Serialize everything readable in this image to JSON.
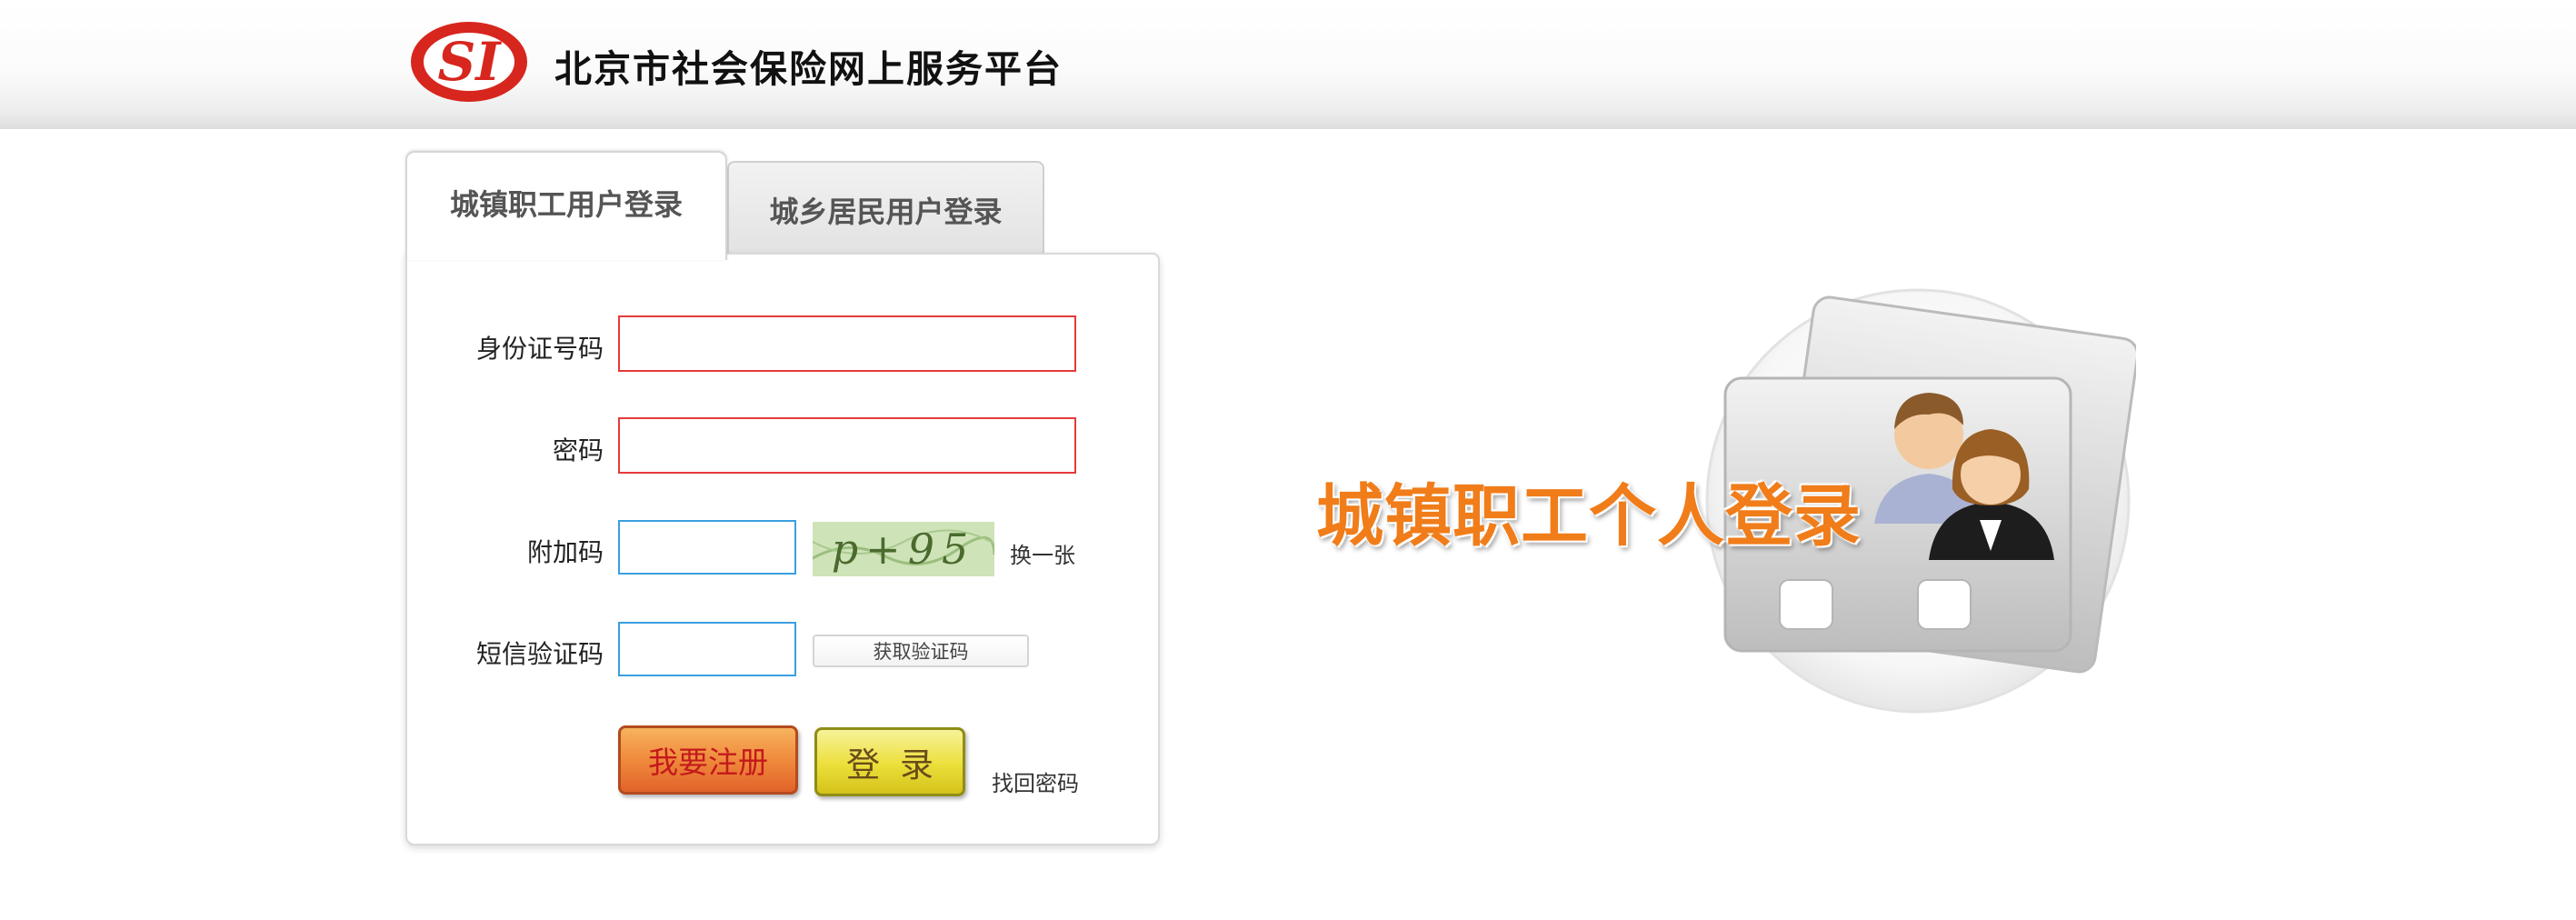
{
  "header": {
    "logo_text": "SI",
    "site_title": "北京市社会保险网上服务平台"
  },
  "tabs": [
    {
      "label": "城镇职工用户登录",
      "active": true
    },
    {
      "label": "城乡居民用户登录",
      "active": false
    }
  ],
  "form": {
    "id_label": "身份证号码",
    "password_label": "密码",
    "captcha_label": "附加码",
    "sms_label": "短信验证码",
    "captcha_text": "p+95",
    "refresh_captcha": "换一张",
    "get_sms_code": "获取验证码",
    "register_button": "我要注册",
    "login_button": "登录",
    "forgot_password": "找回密码"
  },
  "banner": {
    "text": "城镇职工个人登录"
  },
  "colors": {
    "accent_orange": "#f07d1a",
    "logo_red": "#d7261e",
    "input_error_border": "#e53a3a",
    "input_focus_border": "#3aa0e0"
  }
}
